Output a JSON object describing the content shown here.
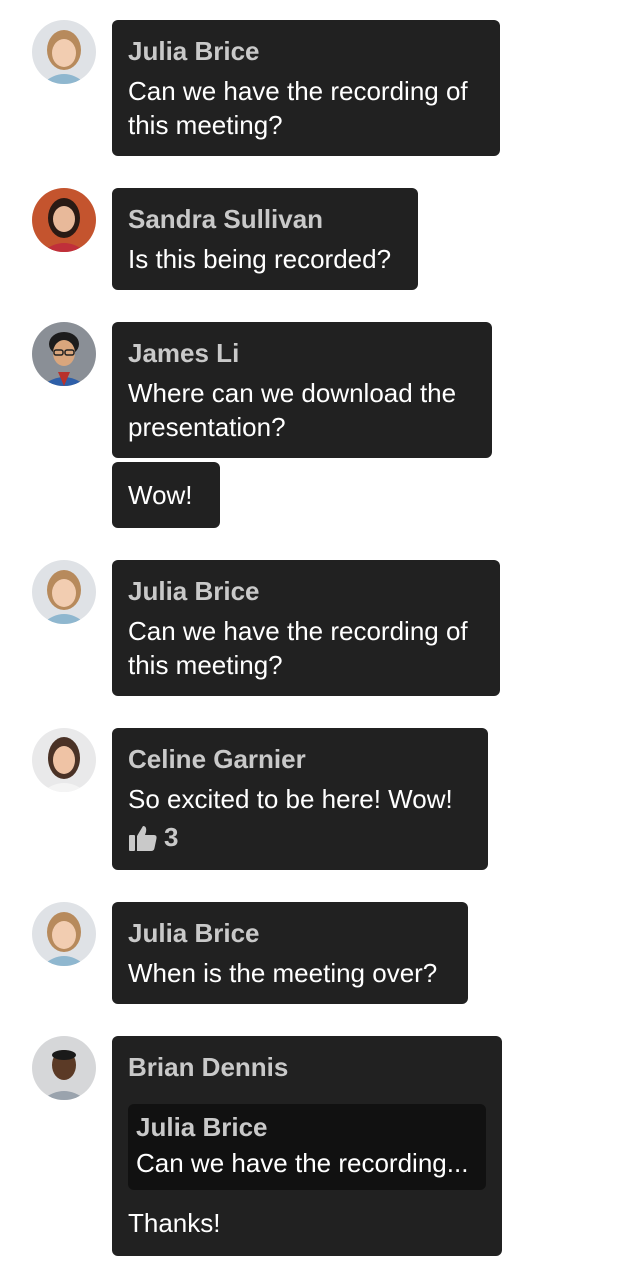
{
  "messages": [
    {
      "name": "Julia Brice",
      "lines": [
        "Can we have the recording of",
        "this meeting?"
      ]
    },
    {
      "name": "Sandra Sullivan",
      "lines": [
        "Is this being recorded?"
      ]
    },
    {
      "name": "James Li",
      "lines": [
        "Where can we download the",
        "presentation?"
      ]
    },
    {
      "lines": [
        "Wow!"
      ]
    },
    {
      "name": "Julia Brice",
      "lines": [
        "Can we have the recording of",
        "this meeting?"
      ]
    },
    {
      "name": "Celine Garnier",
      "lines": [
        "So excited to be here! Wow!"
      ],
      "reaction": {
        "icon": "thumbs-up-icon",
        "count": "3"
      }
    },
    {
      "name": "Julia Brice",
      "lines": [
        "When is the meeting over?"
      ]
    },
    {
      "name": "Brian Dennis",
      "quote": {
        "name": "Julia Brice",
        "text": "Can we have the recording..."
      },
      "lines": [
        "Thanks!"
      ]
    }
  ],
  "colors": {
    "bubble": "#212121",
    "name": "#c9c9c9",
    "text": "#ffffff",
    "quote_bg": "#111111",
    "page_bg": "#ffffff"
  }
}
